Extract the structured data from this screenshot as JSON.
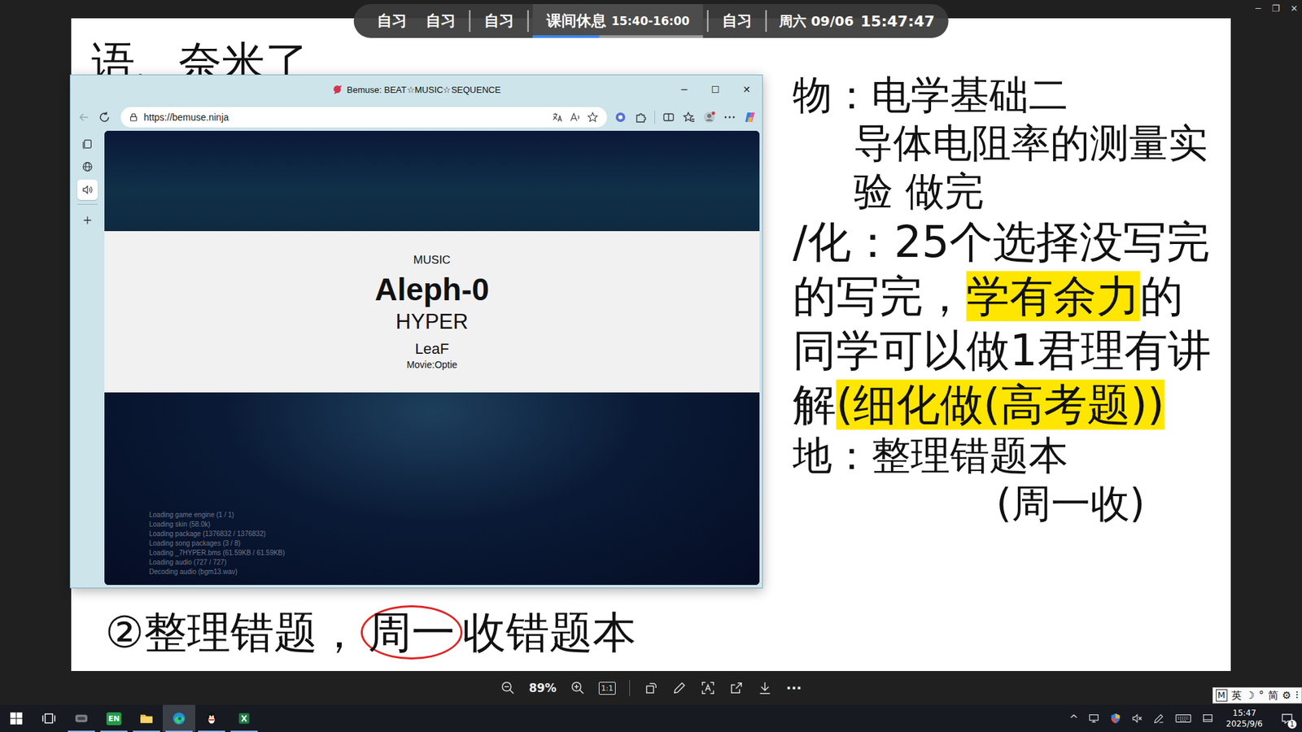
{
  "schedule_bar": {
    "groups": [
      {
        "items": [
          {
            "label": "自习",
            "time": "",
            "selected": false
          },
          {
            "label": "自习",
            "time": "",
            "selected": false
          }
        ]
      },
      {
        "items": [
          {
            "label": "自习",
            "time": "",
            "selected": false
          }
        ]
      },
      {
        "items": [
          {
            "label": "课间休息",
            "time": "15:40-16:00",
            "selected": true
          }
        ]
      },
      {
        "items": [
          {
            "label": "自习",
            "time": "",
            "selected": false
          }
        ]
      }
    ],
    "date": "周六 09/06",
    "clock": "15:47:47",
    "level": 0.39
  },
  "viewer_window_controls": [
    "─",
    "❐",
    "✕"
  ],
  "document": {
    "top_left": "语、奈米了",
    "notes": [
      {
        "kind": "head",
        "segments": [
          {
            "text": "物：电学基础二",
            "highlight": false
          }
        ]
      },
      {
        "kind": "sub",
        "segments": [
          {
            "text": "导体电阻率的测量实验 做完",
            "highlight": false
          }
        ]
      },
      {
        "kind": "big",
        "segments": [
          {
            "text": "/化：25个选择没写完的写完，",
            "highlight": false
          },
          {
            "text": "学有余力",
            "highlight": true
          },
          {
            "text": "的同学可以做1君理有讲解",
            "highlight": false
          },
          {
            "text": "(细化做(高考题))",
            "highlight": true
          }
        ]
      },
      {
        "kind": "head",
        "segments": [
          {
            "text": "地：整理错题本",
            "highlight": false
          }
        ]
      },
      {
        "kind": "far",
        "segments": [
          {
            "text": "(周一收)",
            "highlight": false
          }
        ]
      }
    ],
    "bottom": {
      "before": "②整理错题，",
      "circled": "周一",
      "after": "收错题本"
    }
  },
  "browser": {
    "title": "Bemuse: BEAT☆MUSIC☆SEQUENCE",
    "url": "https://bemuse.ninja",
    "window_controls": [
      "─",
      "☐",
      "✕"
    ],
    "sidebar": [
      {
        "kind": "tabs",
        "selected": false
      },
      {
        "kind": "globe",
        "selected": false
      },
      {
        "kind": "sound",
        "selected": true
      },
      {
        "kind": "add",
        "selected": false
      }
    ],
    "page": {
      "category": "MUSIC",
      "title": "Aleph-0",
      "difficulty": "HYPER",
      "artist": "LeaF",
      "credit": "Movie:Optie",
      "loading": [
        "Loading game engine (1 / 1)",
        "Loading skin (58.0k)",
        "Loading package (1376832 / 1376832)",
        "Loading song packages (3 / 8)",
        "Loading _7HYPER.bms (61.59KB / 61.59KB)",
        "Loading audio (727 / 727)",
        "Decoding audio (bgm13.wav)"
      ]
    }
  },
  "toolbar": {
    "zoom": "89%",
    "actual_size": "1:1",
    "more": "···"
  },
  "ime": [
    "M",
    "英",
    "☽",
    "°",
    "简",
    "⚙",
    "⁝"
  ],
  "taskbar": {
    "apps": [
      {
        "kind": "start",
        "label": "",
        "running": false,
        "selected": false
      },
      {
        "kind": "taskview",
        "label": "",
        "running": false,
        "selected": false
      },
      {
        "kind": "app",
        "label": "",
        "running": true,
        "selected": false
      },
      {
        "kind": "en",
        "label": "EN",
        "running": true,
        "selected": false
      },
      {
        "kind": "folder",
        "label": "",
        "running": true,
        "selected": false
      },
      {
        "kind": "edge",
        "label": "",
        "running": true,
        "selected": true
      },
      {
        "kind": "qq",
        "label": "",
        "running": true,
        "selected": false
      },
      {
        "kind": "excel",
        "label": "",
        "running": true,
        "selected": false
      }
    ],
    "tray_chevron": "^",
    "volume_muted": true,
    "time": "15:47",
    "date": "2025/9/6",
    "notifications": "1"
  }
}
